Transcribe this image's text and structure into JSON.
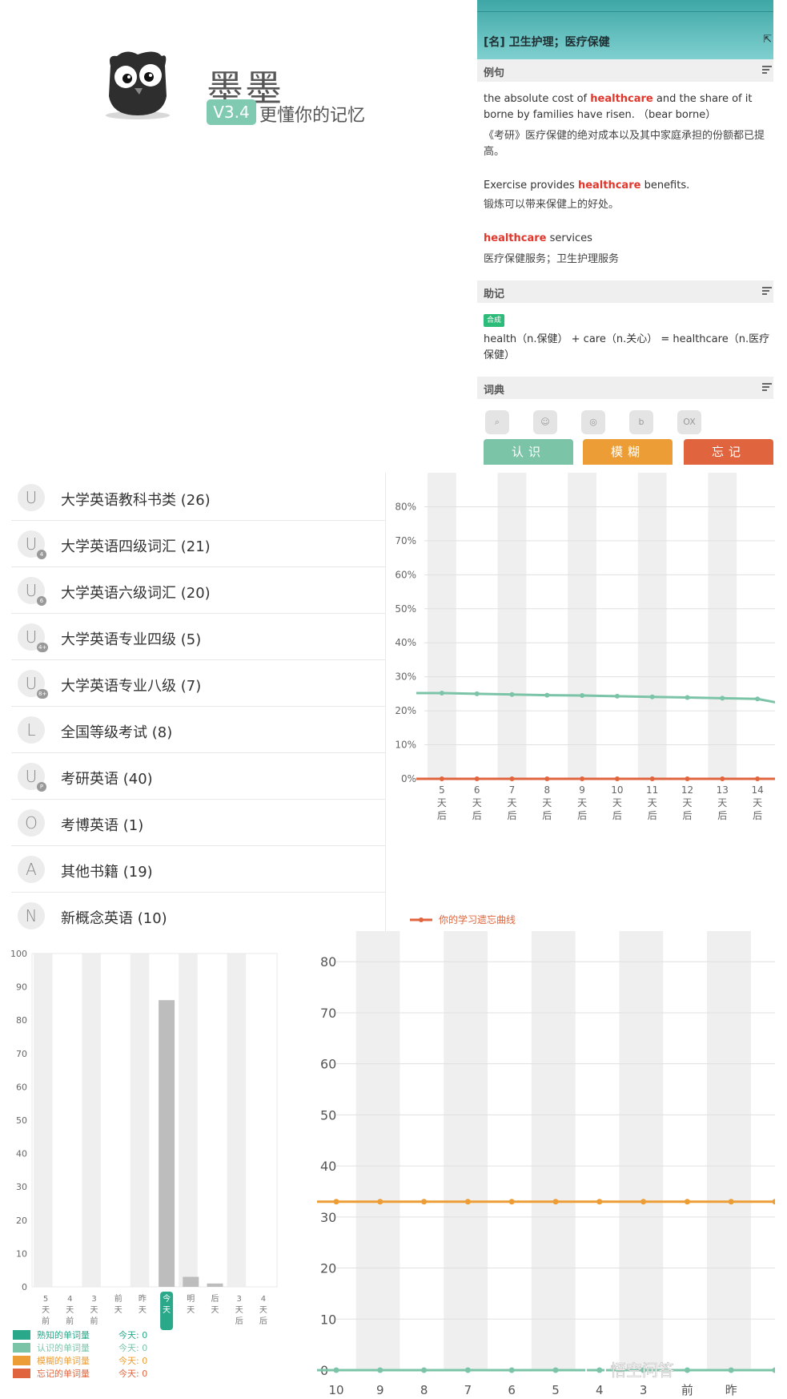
{
  "logo": {
    "app_name": "墨墨",
    "version": "V3.4",
    "slogan": "更懂你的记忆",
    "owl_icon": "owl-logo-icon"
  },
  "word_card": {
    "definition": "[名] 卫生护理；医疗保健",
    "sections": {
      "examples": "例句",
      "mnemonic": "助记",
      "dictionary": "词典"
    },
    "examples": [
      {
        "pre": "the absolute cost of ",
        "hl": "healthcare",
        "post": " and the share of it borne by families have risen. （bear  borne）",
        "cn": "《考研》医疗保健的绝对成本以及其中家庭承担的份额都已提高。"
      },
      {
        "pre": "Exercise provides ",
        "hl": "healthcare",
        "post": " benefits.",
        "cn": "锻炼可以带来保健上的好处。"
      },
      {
        "pre": "",
        "hl": "healthcare",
        "post": " services",
        "cn": "医疗保健服务；卫生护理服务"
      }
    ],
    "mnemonic_tag": "合成",
    "mnemonic_text": "health（n.保健） + care（n.关心） = healthcare（n.医疗保健）",
    "dict_icons": [
      "search-dict-icon",
      "user-dict-icon",
      "q-dict-icon",
      "bing-dict-icon",
      "oxford-dict-icon"
    ],
    "oxford_label": "OX",
    "buttons": {
      "know": "认识",
      "vague": "模糊",
      "forget": "忘记"
    },
    "colors": {
      "know": "#7cc4a8",
      "vague": "#ed9d35",
      "forget": "#e0653e",
      "highlight": "#e0362c"
    }
  },
  "book_list": {
    "top_partial": "",
    "items": [
      {
        "icon": "U",
        "sub": "",
        "label": "大学英语教科书类 (26)"
      },
      {
        "icon": "U",
        "sub": "4",
        "label": "大学英语四级词汇 (21)"
      },
      {
        "icon": "U",
        "sub": "6",
        "label": "大学英语六级词汇 (20)"
      },
      {
        "icon": "U",
        "sub": "4+",
        "label": "大学英语专业四级 (5)"
      },
      {
        "icon": "U",
        "sub": "8+",
        "label": "大学英语专业八级 (7)"
      },
      {
        "icon": "L",
        "sub": "",
        "label": "全国等级考试 (8)"
      },
      {
        "icon": "U",
        "sub": "P",
        "label": "考研英语 (40)"
      },
      {
        "icon": "O",
        "sub": "",
        "label": "考博英语 (1)"
      },
      {
        "icon": "A",
        "sub": "",
        "label": "其他书籍 (19)"
      },
      {
        "icon": "N",
        "sub": "",
        "label": "新概念英语 (10)"
      }
    ]
  },
  "chart_data": [
    {
      "type": "line",
      "yticks": [
        "0%",
        "10%",
        "20%",
        "30%",
        "40%",
        "50%",
        "60%",
        "70%",
        "80%"
      ],
      "ylim": [
        0,
        90
      ],
      "categories": [
        "5天后",
        "6天后",
        "7天后",
        "8天后",
        "9天后",
        "10天后",
        "11天后",
        "12天后",
        "13天后",
        "14天后"
      ],
      "category_parts": [
        [
          "5",
          "天",
          "后"
        ],
        [
          "6",
          "天",
          "后"
        ],
        [
          "7",
          "天",
          "后"
        ],
        [
          "8",
          "天",
          "后"
        ],
        [
          "9",
          "天",
          "后"
        ],
        [
          "10",
          "天",
          "后"
        ],
        [
          "11",
          "天",
          "后"
        ],
        [
          "12",
          "天",
          "后"
        ],
        [
          "13",
          "天",
          "后"
        ],
        [
          "14",
          "天",
          "后"
        ]
      ],
      "series": [
        {
          "color": "#7cc4a8",
          "values": [
            25.2,
            25.0,
            24.8,
            24.6,
            24.5,
            24.3,
            24.1,
            23.9,
            23.7,
            23.5
          ]
        },
        {
          "name": "你的学习遗忘曲线",
          "color": "#e0653e",
          "values": [
            0,
            0,
            0,
            0,
            0,
            0,
            0,
            0,
            0,
            0
          ]
        }
      ],
      "legend": "bottom-left",
      "grid": true
    },
    {
      "type": "bar",
      "yticks": [
        0,
        10,
        20,
        30,
        40,
        50,
        60,
        70,
        80,
        90,
        100
      ],
      "ylim": [
        0,
        100
      ],
      "categories": [
        "5天前",
        "4天前",
        "3天前",
        "前天",
        "昨天",
        "今天",
        "明天",
        "后天",
        "3天后",
        "4天后"
      ],
      "category_parts": [
        [
          "5",
          "天",
          "前"
        ],
        [
          "4",
          "天",
          "前"
        ],
        [
          "3",
          "天",
          "前"
        ],
        [
          "前",
          "天"
        ],
        [
          "昨",
          "天"
        ],
        [
          "今",
          "天"
        ],
        [
          "明",
          "天"
        ],
        [
          "后",
          "天"
        ],
        [
          "3",
          "天",
          "后"
        ],
        [
          "4",
          "天",
          "后"
        ]
      ],
      "values": [
        0,
        0,
        0,
        0,
        0,
        86,
        3,
        1,
        0,
        0
      ],
      "highlight_index": 5,
      "legend": [
        {
          "name": "熟知的单词量",
          "today": "今天: 0",
          "color": "#2aa88a"
        },
        {
          "name": "认识的单词量",
          "today": "今天: 0",
          "color": "#7cc4a8"
        },
        {
          "name": "模糊的单词量",
          "today": "今天: 0",
          "color": "#ed9d35"
        },
        {
          "name": "忘记的单词量",
          "today": "今天: 0",
          "color": "#e0653e"
        }
      ]
    },
    {
      "type": "line",
      "yticks": [
        0,
        10,
        20,
        30,
        40,
        50,
        60,
        70,
        80
      ],
      "ylim": [
        0,
        80
      ],
      "categories": [
        "10",
        "9",
        "8",
        "7",
        "6",
        "5",
        "4",
        "3",
        "前",
        "昨"
      ],
      "series": [
        {
          "color": "#ed9d35",
          "values": [
            33,
            33,
            33,
            33,
            33,
            33,
            33,
            33,
            33,
            33,
            33
          ]
        },
        {
          "color": "#7cc4a8",
          "values": [
            0,
            0,
            0,
            0,
            0,
            0,
            0,
            0,
            0,
            0,
            0
          ]
        }
      ],
      "grid": true,
      "watermark": "悟空问答"
    }
  ]
}
